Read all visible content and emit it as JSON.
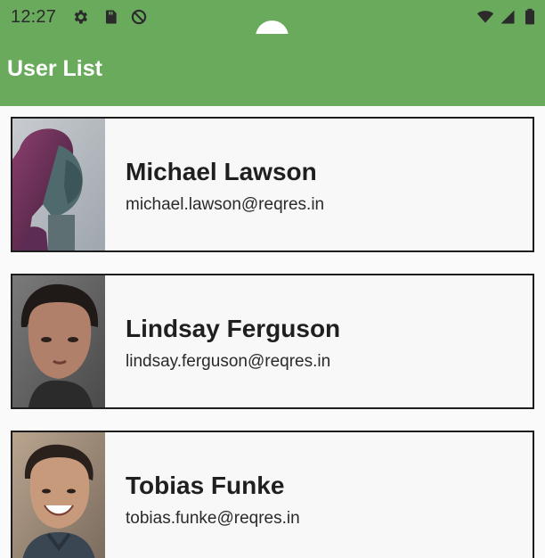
{
  "status_bar": {
    "time": "12:27",
    "left_icons": [
      "gear-icon",
      "sd-card-icon",
      "do-not-disturb-icon"
    ],
    "right_icons": [
      "wifi-icon",
      "signal-icon",
      "battery-icon"
    ]
  },
  "app_bar": {
    "title": "User List"
  },
  "colors": {
    "primary": "#6aaa5c",
    "card_background": "#f8f8f8",
    "card_border": "#1d1d1d"
  },
  "users": [
    {
      "name": "Michael Lawson",
      "email": "michael.lawson@reqres.in",
      "avatar_icon": "avatar-image"
    },
    {
      "name": "Lindsay Ferguson",
      "email": "lindsay.ferguson@reqres.in",
      "avatar_icon": "avatar-image"
    },
    {
      "name": "Tobias Funke",
      "email": "tobias.funke@reqres.in",
      "avatar_icon": "avatar-image"
    }
  ]
}
